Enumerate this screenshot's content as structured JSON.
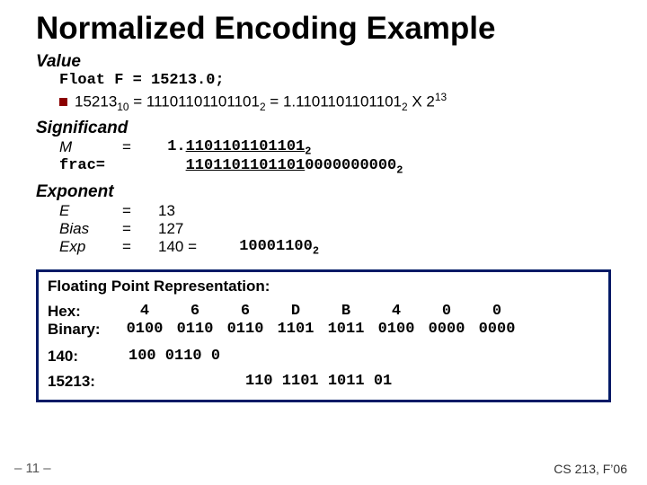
{
  "title": "Normalized Encoding Example",
  "value": {
    "heading": "Value",
    "decl": "Float F = 15213.0;",
    "line": "15213",
    "line_sub1": "10",
    "line_mid": " = 11101101101101",
    "line_sub2": "2",
    "line_mid2": " = 1.1101101101101",
    "line_sub3": "2",
    "line_tail1": " X 2",
    "line_sup": "13"
  },
  "significand": {
    "heading": "Significand",
    "m_label": "M",
    "m_eq": "=",
    "m_val_pre": "1.",
    "m_val_u": "1101101101101",
    "m_sub": "2",
    "frac_label": "frac=",
    "frac_val_u": "1101101101101",
    "frac_val_tail": "0000000000",
    "frac_sub": "2"
  },
  "exponent": {
    "heading": "Exponent",
    "e_label": "E",
    "e_eq": "=",
    "e_val": "13",
    "bias_label": "Bias",
    "bias_eq": "=",
    "bias_val": "127",
    "exp_label": "Exp",
    "exp_eq": "=",
    "exp_val": "140 =",
    "exp_bin": "10001100",
    "exp_bin_sub": "2"
  },
  "box": {
    "title": "Floating Point Representation:",
    "hex_label": "Hex:",
    "bin_label": "Binary:",
    "hex": [
      "4",
      "6",
      "6",
      "D",
      "B",
      "4",
      "0",
      "0"
    ],
    "bin": [
      "0100",
      "0110",
      "0110",
      "1101",
      "1011",
      "0100",
      "0000",
      "0000"
    ],
    "row140_label": "140:",
    "row140_val": "100 0110 0",
    "row15213_label": "15213:",
    "row15213_val": "110 1101 1011 01"
  },
  "footer": {
    "left": "– 11 –",
    "right": "CS 213, F’06"
  }
}
